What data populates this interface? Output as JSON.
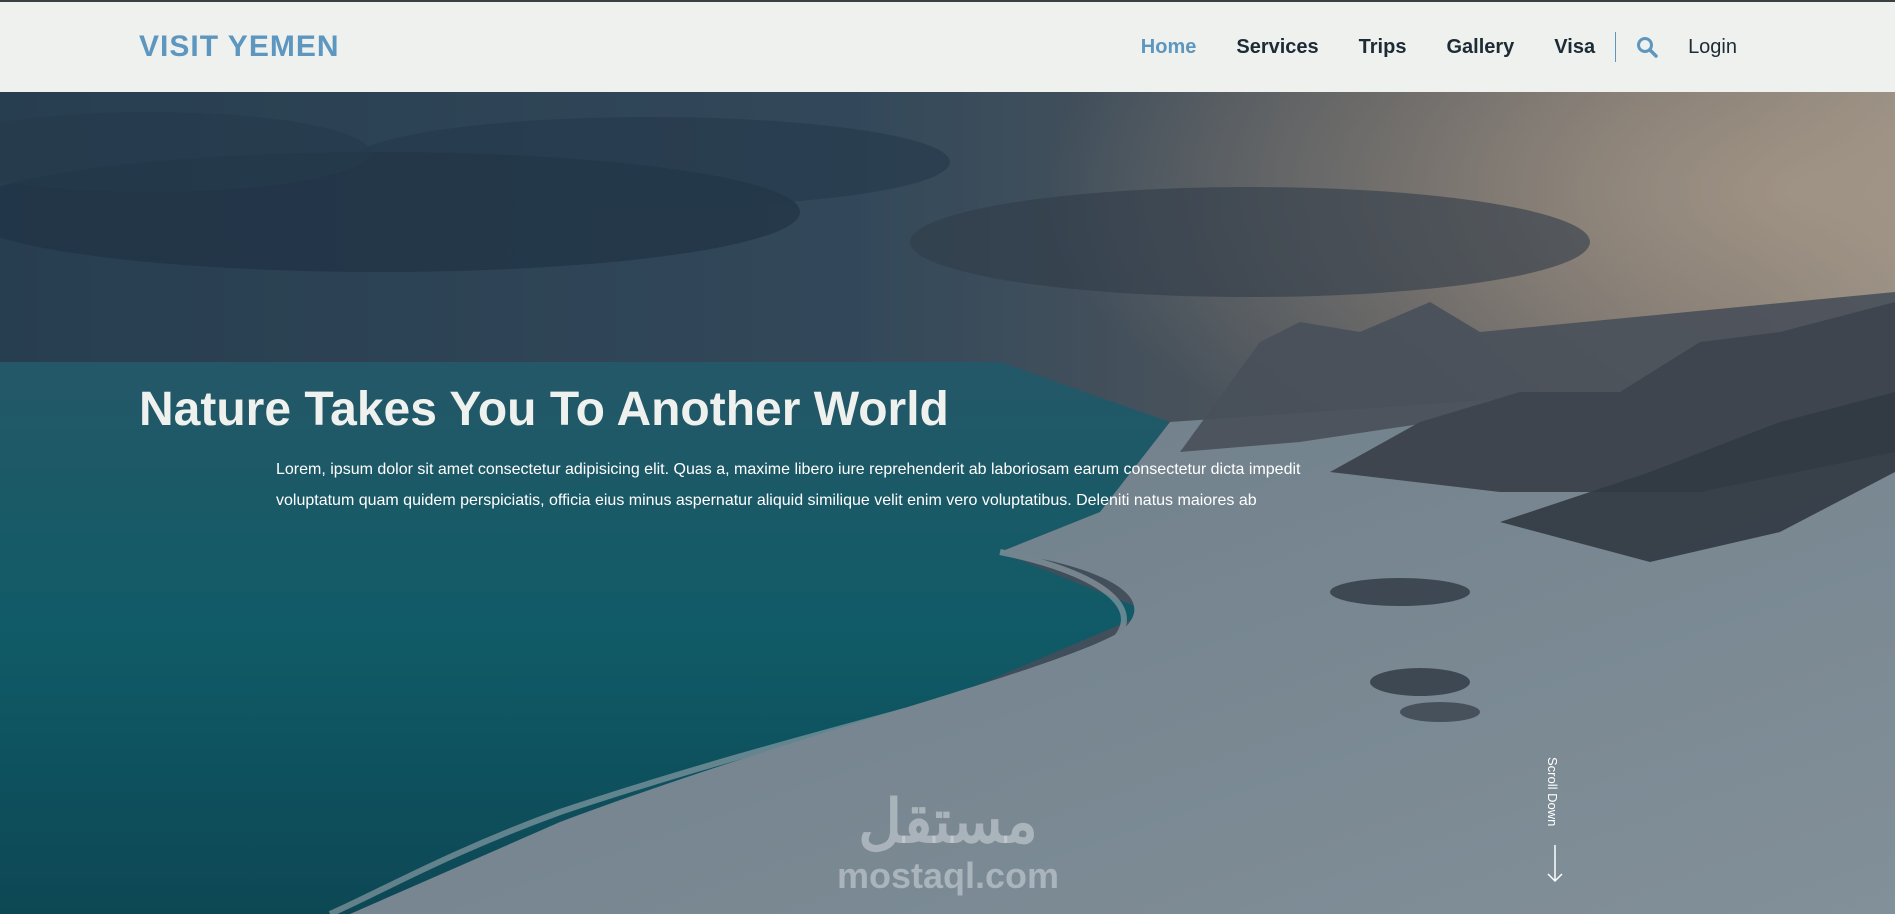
{
  "header": {
    "logo": "VISIT YEMEN",
    "nav": [
      {
        "label": "Home",
        "active": true
      },
      {
        "label": "Services",
        "active": false
      },
      {
        "label": "Trips",
        "active": false
      },
      {
        "label": "Gallery",
        "active": false
      },
      {
        "label": "Visa",
        "active": false
      }
    ],
    "search_icon": "search-icon",
    "login_label": "Login"
  },
  "hero": {
    "title": "Nature Takes You To Another World",
    "text": "Lorem, ipsum dolor sit amet consectetur adipisicing elit. Quas a, maxime libero iure reprehenderit ab laboriosam earum consectetur dicta impedit voluptatum quam quidem perspiciatis, officia eius minus aspernatur aliquid similique velit enim vero voluptatibus. Deleniti natus maiores ab",
    "scroll_label": "Scroll Down",
    "scroll_icon": "arrow-down-icon"
  },
  "watermark": {
    "arabic": "مستقل",
    "latin": "mostaql.com"
  },
  "colors": {
    "accent": "#5d97c0",
    "header_bg": "#eef1ed",
    "nav_text": "#1d2b36"
  }
}
